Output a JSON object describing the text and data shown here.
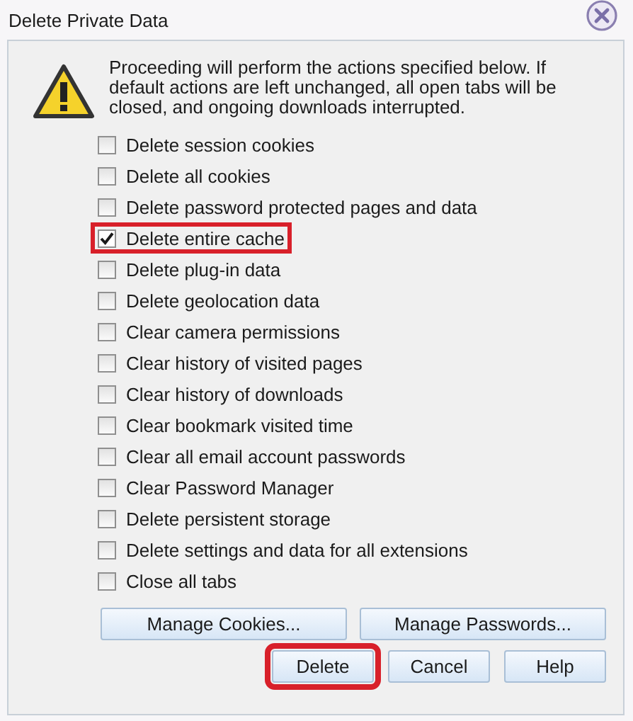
{
  "window": {
    "title": "Delete Private Data"
  },
  "message": "Proceeding will perform the actions specified below. If default actions are left unchanged, all open tabs will be closed, and ongoing downloads interrupted.",
  "options": [
    {
      "label": "Delete session cookies",
      "checked": false,
      "highlighted": false
    },
    {
      "label": "Delete all cookies",
      "checked": false,
      "highlighted": false
    },
    {
      "label": "Delete password protected pages and data",
      "checked": false,
      "highlighted": false
    },
    {
      "label": "Delete entire cache",
      "checked": true,
      "highlighted": true
    },
    {
      "label": "Delete plug-in data",
      "checked": false,
      "highlighted": false
    },
    {
      "label": "Delete geolocation data",
      "checked": false,
      "highlighted": false
    },
    {
      "label": "Clear camera permissions",
      "checked": false,
      "highlighted": false
    },
    {
      "label": "Clear history of visited pages",
      "checked": false,
      "highlighted": false
    },
    {
      "label": "Clear history of downloads",
      "checked": false,
      "highlighted": false
    },
    {
      "label": "Clear bookmark visited time",
      "checked": false,
      "highlighted": false
    },
    {
      "label": "Clear all email account passwords",
      "checked": false,
      "highlighted": false
    },
    {
      "label": "Clear Password Manager",
      "checked": false,
      "highlighted": false
    },
    {
      "label": "Delete persistent storage",
      "checked": false,
      "highlighted": false
    },
    {
      "label": "Delete settings and data for all extensions",
      "checked": false,
      "highlighted": false
    },
    {
      "label": "Close all tabs",
      "checked": false,
      "highlighted": false
    }
  ],
  "manage_buttons": [
    "Manage Cookies...",
    "Manage Passwords..."
  ],
  "buttons": [
    {
      "label": "Delete",
      "highlighted": true
    },
    {
      "label": "Cancel",
      "highlighted": false
    },
    {
      "label": "Help",
      "highlighted": false
    }
  ]
}
